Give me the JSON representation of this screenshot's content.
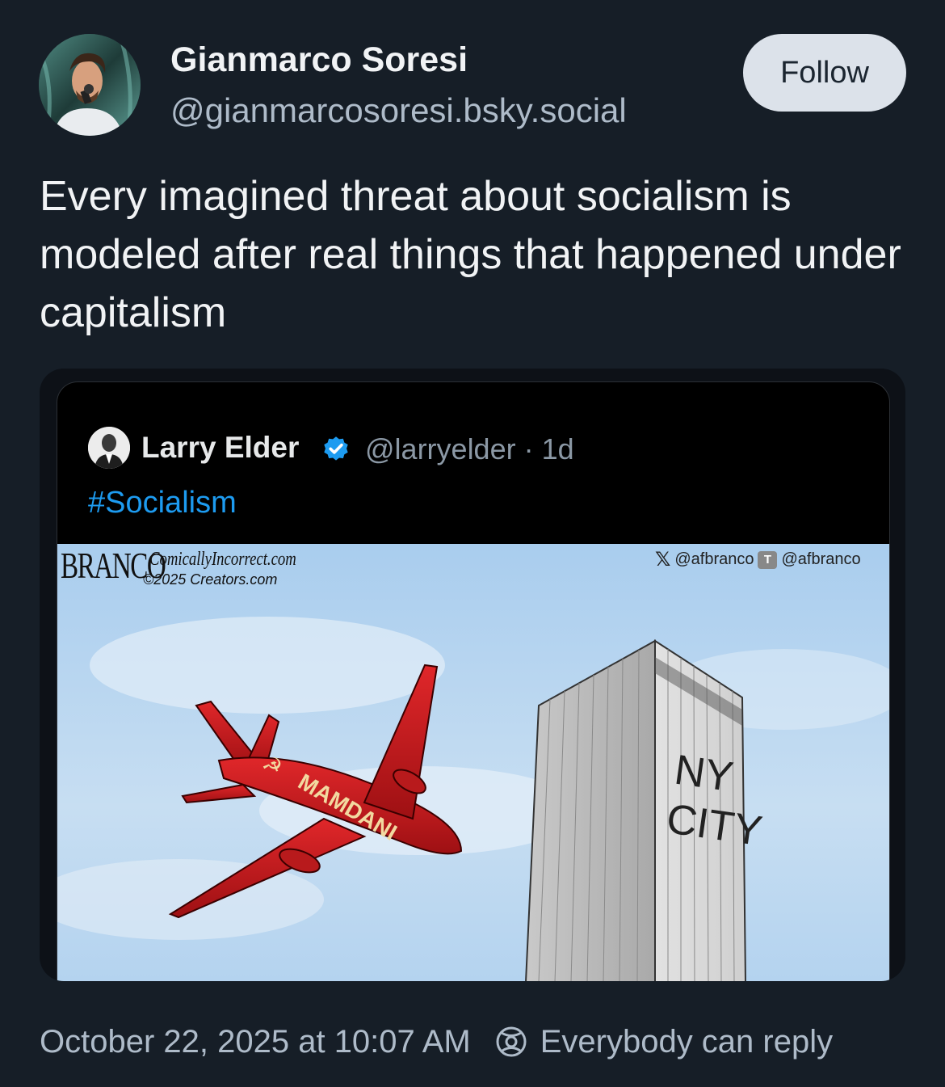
{
  "post": {
    "author": {
      "display_name": "Gianmarco Soresi",
      "handle": "@gianmarcosoresi.bsky.social"
    },
    "follow_label": "Follow",
    "text": "Every imagined threat about socialism is modeled after real things that happened under capitalism",
    "timestamp": "October 22, 2025 at 10:07 AM",
    "reply_setting": "Everybody can reply"
  },
  "quoted": {
    "name": "Larry Elder",
    "meta": "@larryelder · 1d",
    "hashtag": "#Socialism",
    "cartoon": {
      "signature": "BRANCO",
      "site": "ComicallyIncorrect.com",
      "copyright": "©2025 Creators.com",
      "x_handle": "@afbranco",
      "t_letter": "T",
      "truth_handle": "@afbranco",
      "plane_label": "MAMDANI",
      "building_label_line1": "NY",
      "building_label_line2": "CITY"
    }
  },
  "colors": {
    "background": "#161e27",
    "follow_button": "#dce2ea",
    "hashtag": "#1d9bf0",
    "verified": "#1d9bf0",
    "plane": "#c8181b",
    "sky": "#c4ddf2"
  },
  "icons": {
    "verified": "verified-badge-icon",
    "reply": "reply-permission-icon",
    "x": "x-logo-icon"
  }
}
